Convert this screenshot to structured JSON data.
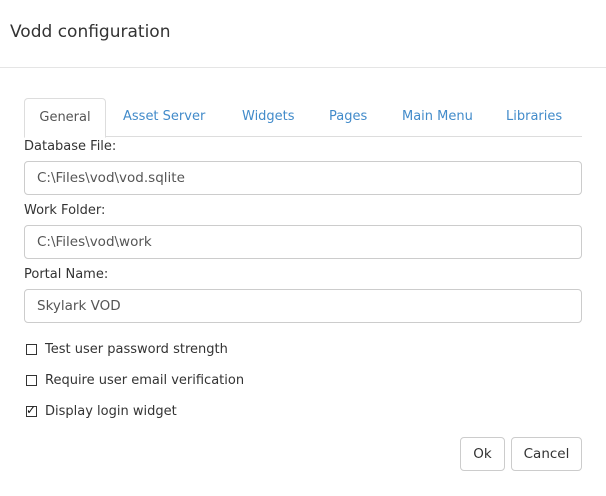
{
  "dialog": {
    "title": "Vodd configuration"
  },
  "tabs": [
    {
      "label": "General",
      "active": true
    },
    {
      "label": "Asset Server",
      "active": false
    },
    {
      "label": "Widgets",
      "active": false
    },
    {
      "label": "Pages",
      "active": false
    },
    {
      "label": "Main Menu",
      "active": false
    },
    {
      "label": "Libraries",
      "active": false
    }
  ],
  "form": {
    "database_file": {
      "label": "Database File:",
      "value": "C:\\Files\\vod\\vod.sqlite"
    },
    "work_folder": {
      "label": "Work Folder:",
      "value": "C:\\Files\\vod\\work"
    },
    "portal_name": {
      "label": "Portal Name:",
      "value": "Skylark VOD"
    }
  },
  "options": [
    {
      "label": "Test user password strength",
      "checked": false
    },
    {
      "label": "Require user email verification",
      "checked": false
    },
    {
      "label": "Display login widget",
      "checked": true
    }
  ],
  "buttons": {
    "ok": "Ok",
    "cancel": "Cancel"
  },
  "colors": {
    "link": "#428bca",
    "border": "#cccccc",
    "text": "#333333"
  }
}
